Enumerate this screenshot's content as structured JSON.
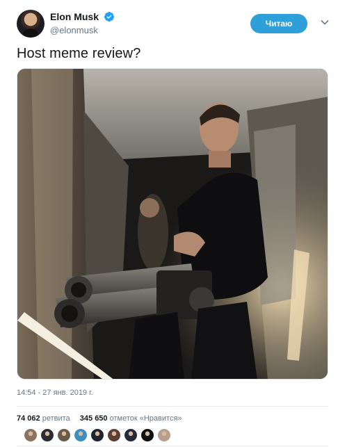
{
  "author": {
    "display_name": "Elon Musk",
    "handle": "@elonmusk",
    "verified": true,
    "avatar_icon": "profile-avatar"
  },
  "follow_button": {
    "label": "Читаю",
    "color": "#2e9fd8"
  },
  "menu_icon": "chevron-down-icon",
  "tweet": {
    "text": "Host meme review?",
    "timestamp": "14:54 - 27 янв. 2019 г."
  },
  "stats": {
    "retweets_count": "74 062",
    "retweets_label": "ретвита",
    "likes_count": "345 650",
    "likes_label": "отметок «Нравится»"
  },
  "likers": [
    {
      "color": "#8a7360"
    },
    {
      "color": "#2b2b33"
    },
    {
      "color": "#6b5a4a"
    },
    {
      "color": "#3a8fbf"
    },
    {
      "color": "#1f2430"
    },
    {
      "color": "#5a4035"
    },
    {
      "color": "#262a3a"
    },
    {
      "color": "#111111"
    },
    {
      "color": "#b8a090"
    }
  ]
}
